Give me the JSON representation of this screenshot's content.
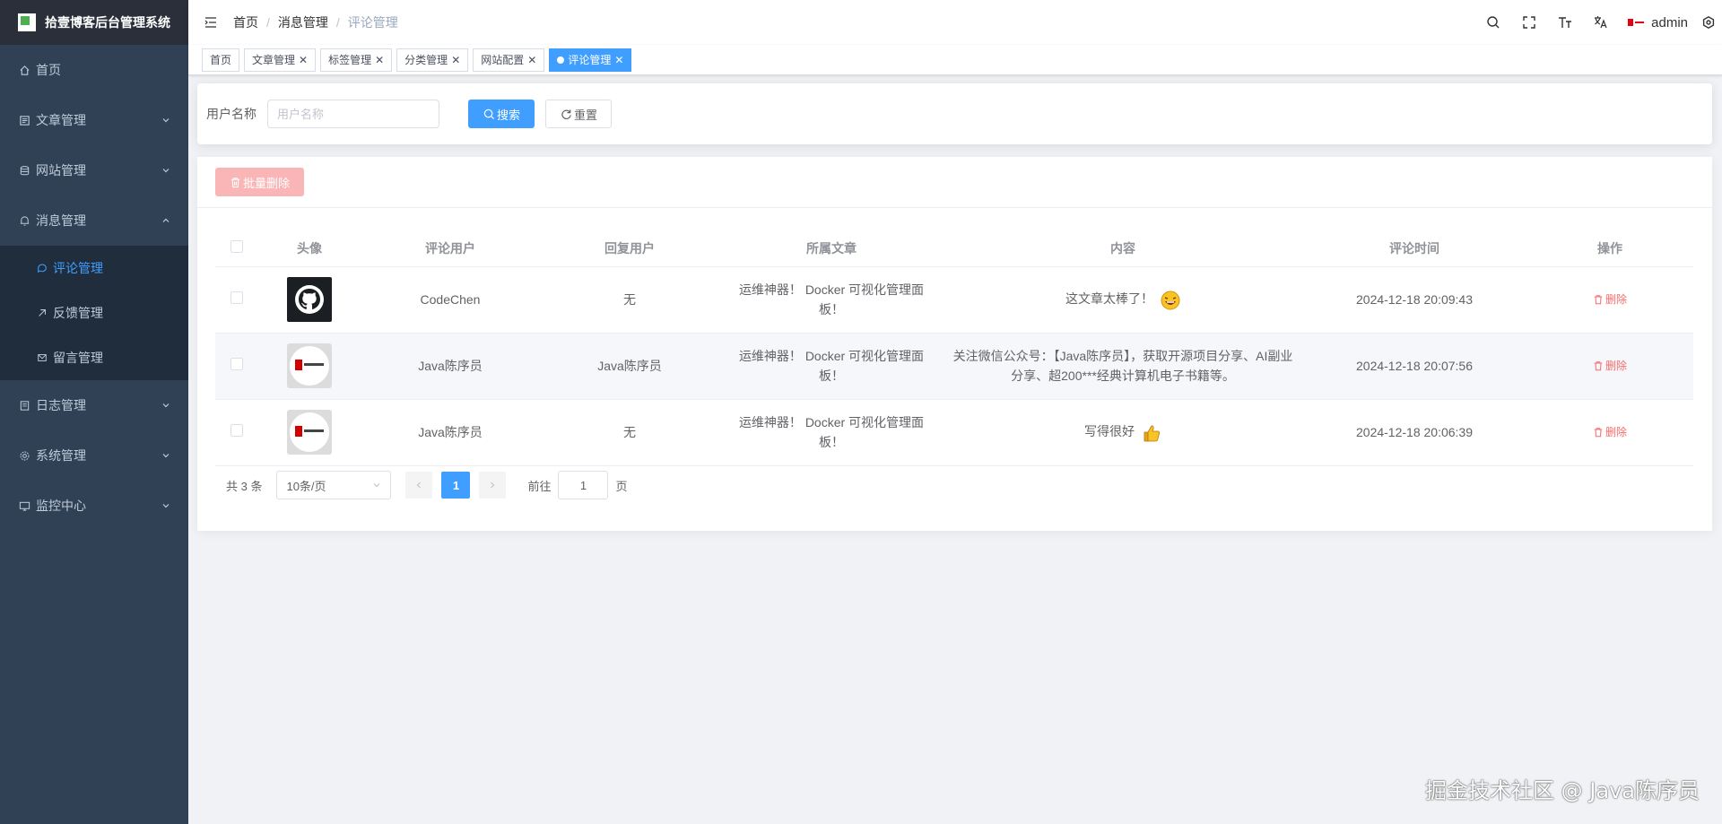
{
  "app": {
    "title": "拾壹博客后台管理系统"
  },
  "sidebar": {
    "items": [
      {
        "label": "首页",
        "icon": "home-icon"
      },
      {
        "label": "文章管理",
        "icon": "document-icon"
      },
      {
        "label": "网站管理",
        "icon": "database-icon"
      },
      {
        "label": "消息管理",
        "icon": "bell-icon",
        "expanded": true
      },
      {
        "label": "日志管理",
        "icon": "log-icon"
      },
      {
        "label": "系统管理",
        "icon": "gear-icon"
      },
      {
        "label": "监控中心",
        "icon": "monitor-icon"
      }
    ],
    "sub_items": [
      {
        "label": "评论管理",
        "icon": "comment-icon",
        "active": true
      },
      {
        "label": "反馈管理",
        "icon": "feedback-icon"
      },
      {
        "label": "留言管理",
        "icon": "mail-icon"
      }
    ]
  },
  "header": {
    "breadcrumb": [
      "首页",
      "消息管理",
      "评论管理"
    ],
    "breadcrumb_sep": "/",
    "user": "admin"
  },
  "tags": [
    {
      "label": "首页",
      "closable": false
    },
    {
      "label": "文章管理",
      "closable": true
    },
    {
      "label": "标签管理",
      "closable": true
    },
    {
      "label": "分类管理",
      "closable": true
    },
    {
      "label": "网站配置",
      "closable": true
    },
    {
      "label": "评论管理",
      "closable": true,
      "active": true
    }
  ],
  "search": {
    "label": "用户名称",
    "placeholder": "用户名称",
    "search_button": "搜索",
    "reset_button": "重置"
  },
  "toolbar": {
    "batch_delete": "批量删除"
  },
  "table": {
    "columns": [
      "头像",
      "评论用户",
      "回复用户",
      "所属文章",
      "内容",
      "评论时间",
      "操作"
    ],
    "rows": [
      {
        "avatar": "github",
        "user": "CodeChen",
        "reply": "无",
        "article": "运维神器！ Docker 可视化管理面板！",
        "content": "这文章太棒了！",
        "emoji": "laugh",
        "time": "2024-12-18 20:09:43",
        "action": "删除"
      },
      {
        "avatar": "java",
        "user": "Java陈序员",
        "reply": "Java陈序员",
        "article": "运维神器！ Docker 可视化管理面板！",
        "content": "关注微信公众号：【Java陈序员】，获取开源项目分享、AI副业分享、超200***经典计算机电子书籍等。",
        "emoji": "",
        "time": "2024-12-18 20:07:56",
        "action": "删除"
      },
      {
        "avatar": "java",
        "user": "Java陈序员",
        "reply": "无",
        "article": "运维神器！ Docker 可视化管理面板！",
        "content": "写得很好",
        "emoji": "thumbs-up",
        "time": "2024-12-18 20:06:39",
        "action": "删除"
      }
    ]
  },
  "pagination": {
    "total": "共 3 条",
    "page_size": "10条/页",
    "current": "1",
    "jump_prefix": "前往",
    "jump_value": "1",
    "jump_suffix": "页"
  },
  "watermark": "掘金技术社区 @ Java陈序员",
  "colors": {
    "sidebar": "#304156",
    "accent": "#409eff",
    "danger": "#f56c6c"
  }
}
